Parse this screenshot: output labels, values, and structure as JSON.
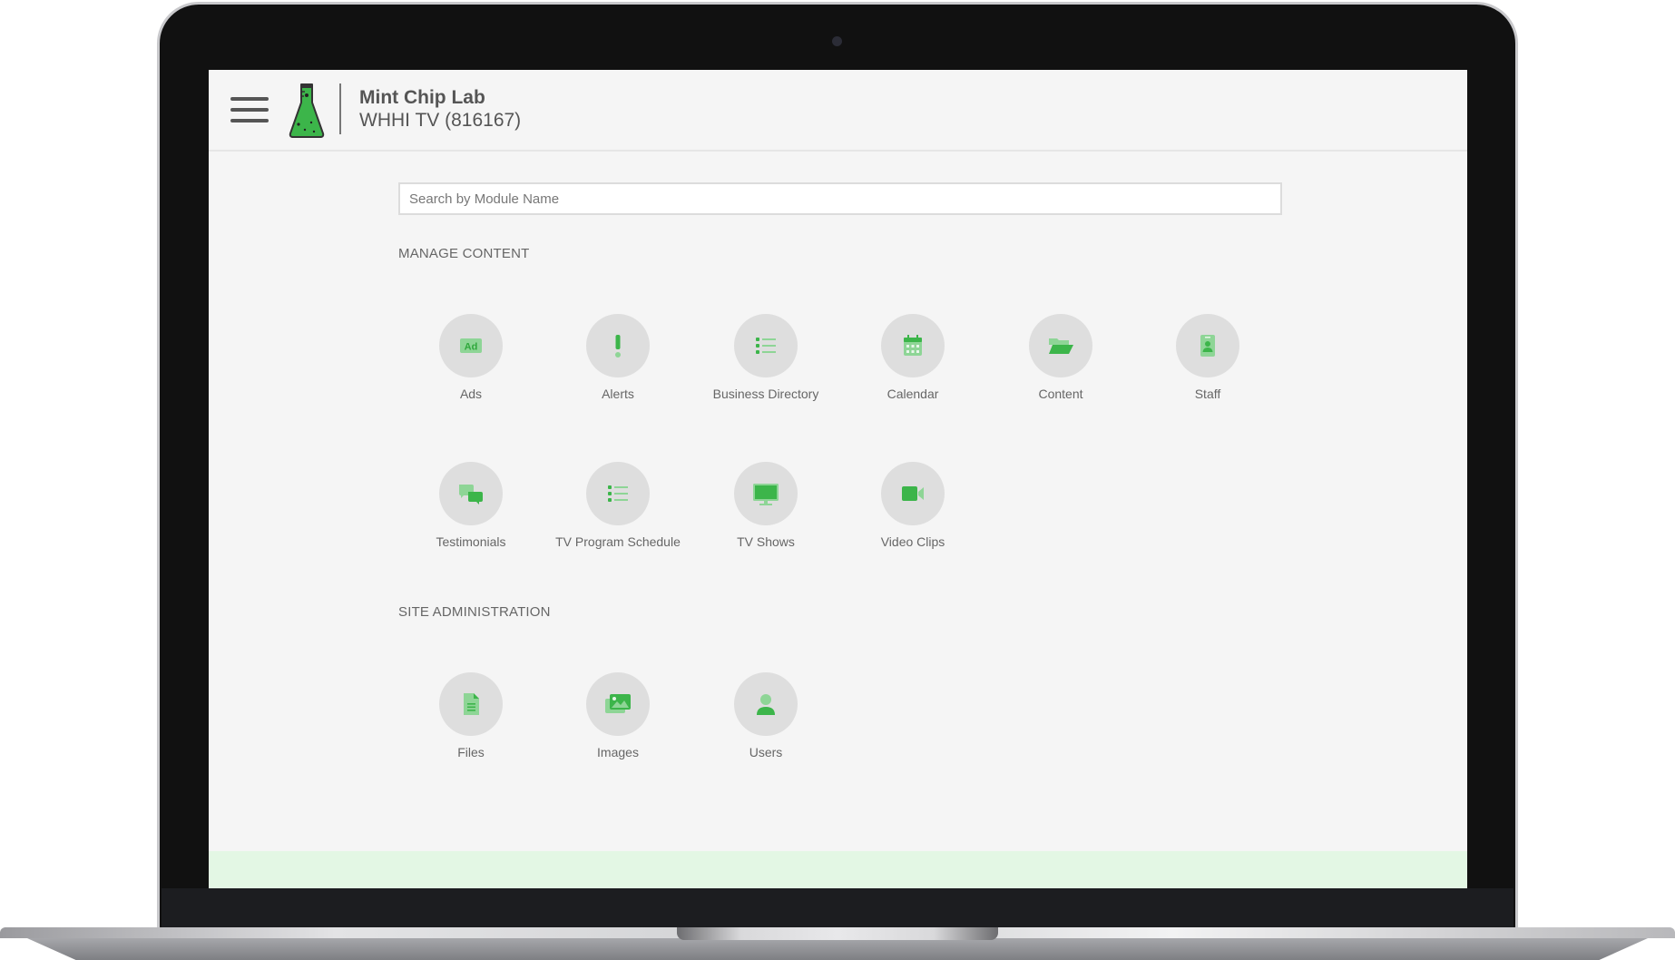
{
  "header": {
    "org_name": "Mint Chip Lab",
    "site_name": "WHHI TV (816167)"
  },
  "search": {
    "placeholder": "Search by Module Name",
    "value": ""
  },
  "colors": {
    "accent": "#3cb54a",
    "accent_light": "#8ed596",
    "tile_bg": "#dedede",
    "page_bg": "#f5f5f5",
    "footer_bg": "#e3f7e4"
  },
  "sections": [
    {
      "title": "MANAGE CONTENT",
      "modules": [
        {
          "label": "Ads",
          "icon": "ad-icon"
        },
        {
          "label": "Alerts",
          "icon": "exclamation-icon"
        },
        {
          "label": "Business Directory",
          "icon": "list-icon"
        },
        {
          "label": "Calendar",
          "icon": "calendar-icon"
        },
        {
          "label": "Content",
          "icon": "folder-open-icon"
        },
        {
          "label": "Staff",
          "icon": "id-badge-icon"
        },
        {
          "label": "Testimonials",
          "icon": "comments-icon"
        },
        {
          "label": "TV Program Schedule",
          "icon": "list-icon"
        },
        {
          "label": "TV Shows",
          "icon": "tv-icon"
        },
        {
          "label": "Video Clips",
          "icon": "video-camera-icon"
        }
      ]
    },
    {
      "title": "SITE ADMINISTRATION",
      "modules": [
        {
          "label": "Files",
          "icon": "file-icon"
        },
        {
          "label": "Images",
          "icon": "images-icon"
        },
        {
          "label": "Users",
          "icon": "user-icon"
        }
      ]
    }
  ]
}
